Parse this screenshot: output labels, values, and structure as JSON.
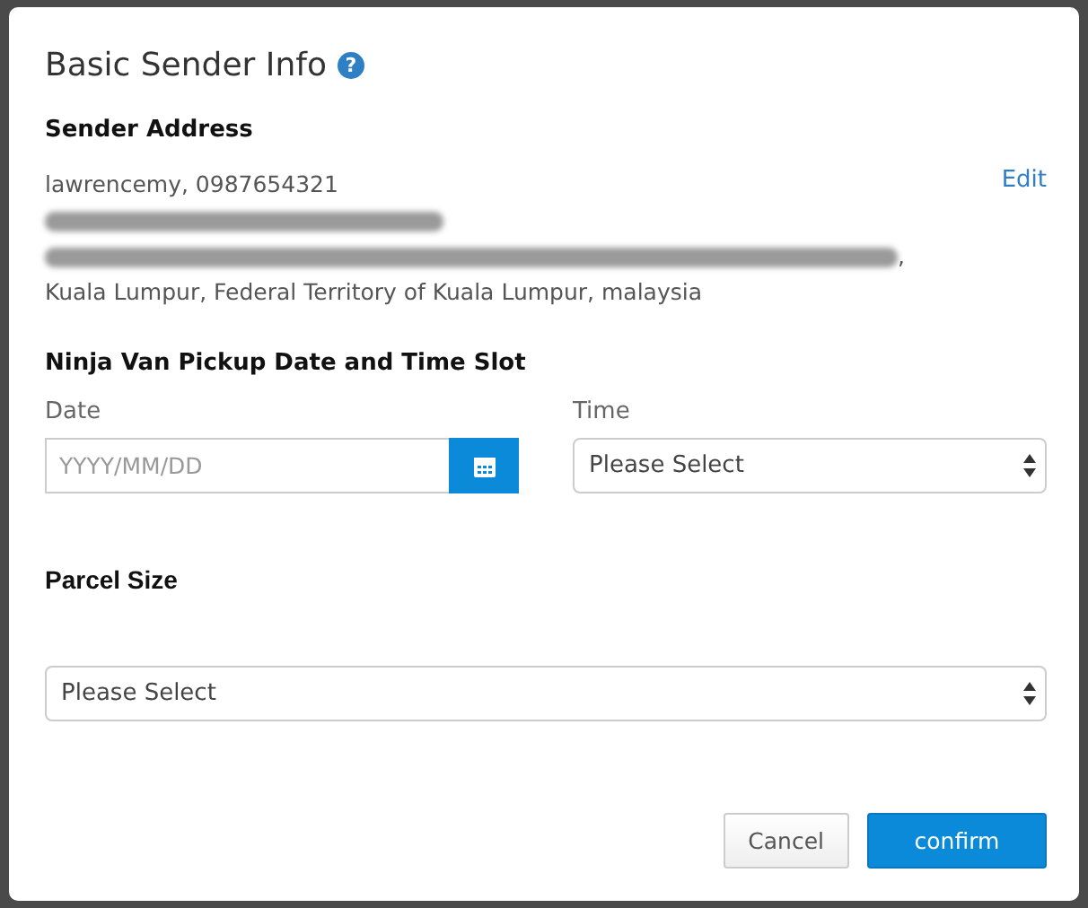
{
  "dialog": {
    "title": "Basic Sender Info",
    "help_icon": "?"
  },
  "sender_address": {
    "heading": "Sender Address",
    "edit_link": "Edit",
    "lines": [
      {
        "kind": "text",
        "text": "lawrencemy, 0987654321"
      },
      {
        "kind": "redacted"
      },
      {
        "kind": "redacted",
        "suffix": ","
      },
      {
        "kind": "text",
        "text": "Kuala Lumpur, Federal Territory of Kuala Lumpur, malaysia"
      }
    ]
  },
  "pickup": {
    "heading": "Ninja Van Pickup Date and Time Slot",
    "date": {
      "label": "Date",
      "placeholder": "YYYY/MM/DD"
    },
    "time": {
      "label": "Time",
      "value": "Please Select"
    }
  },
  "parcel_size": {
    "heading": "Parcel Size",
    "value": "Please Select"
  },
  "buttons": [
    {
      "label": "Cancel",
      "kind": "secondary"
    },
    {
      "label": "confirm",
      "kind": "primary"
    }
  ]
}
